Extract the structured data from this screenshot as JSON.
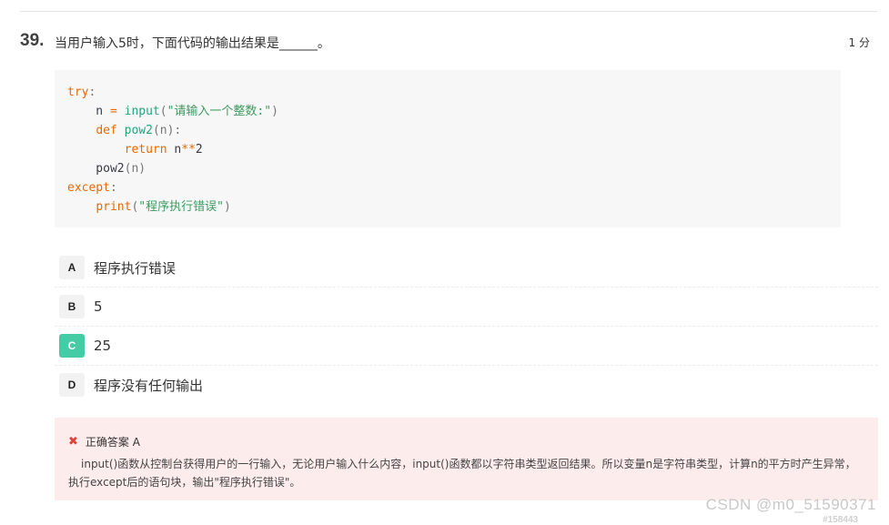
{
  "question": {
    "number": "39.",
    "text": "当用户输入5时，下面代码的输出结果是______。",
    "score": "1 分"
  },
  "code": {
    "lines": [
      [
        {
          "t": "try",
          "c": "kw"
        },
        {
          "t": ":",
          "c": "punc"
        }
      ],
      [
        {
          "t": "    n ",
          "c": ""
        },
        {
          "t": "=",
          "c": "op"
        },
        {
          "t": " ",
          "c": ""
        },
        {
          "t": "input",
          "c": "fn"
        },
        {
          "t": "(",
          "c": "punc"
        },
        {
          "t": "\"请输入一个整数:\"",
          "c": "str"
        },
        {
          "t": ")",
          "c": "punc"
        }
      ],
      [
        {
          "t": "    ",
          "c": ""
        },
        {
          "t": "def",
          "c": "kw"
        },
        {
          "t": " ",
          "c": ""
        },
        {
          "t": "pow2",
          "c": "fn"
        },
        {
          "t": "(n):",
          "c": "punc"
        }
      ],
      [
        {
          "t": "        ",
          "c": ""
        },
        {
          "t": "return",
          "c": "kw"
        },
        {
          "t": " n",
          "c": ""
        },
        {
          "t": "**",
          "c": "op"
        },
        {
          "t": "2",
          "c": ""
        }
      ],
      [
        {
          "t": "    pow2",
          "c": ""
        },
        {
          "t": "(n)",
          "c": "punc"
        }
      ],
      [
        {
          "t": "except",
          "c": "kw"
        },
        {
          "t": ":",
          "c": "punc"
        }
      ],
      [
        {
          "t": "    ",
          "c": ""
        },
        {
          "t": "print",
          "c": "kw"
        },
        {
          "t": "(",
          "c": "punc"
        },
        {
          "t": "\"程序执行错误\"",
          "c": "str"
        },
        {
          "t": ")",
          "c": "punc"
        }
      ]
    ]
  },
  "options": [
    {
      "letter": "A",
      "text": "程序执行错误",
      "correct": false
    },
    {
      "letter": "B",
      "text": "5",
      "correct": false
    },
    {
      "letter": "C",
      "text": "25",
      "correct": true
    },
    {
      "letter": "D",
      "text": "程序没有任何输出",
      "correct": false
    }
  ],
  "answer": {
    "icon": "x-icon",
    "label": "正确答案 A",
    "explanation": "input()函数从控制台获得用户的一行输入，无论用户输入什么内容，input()函数都以字符串类型返回结果。所以变量n是字符串类型，计算n的平方时产生异常，执行except后的语句块，输出\"程序执行错误\"。"
  },
  "watermark": {
    "main": "CSDN @m0_51590371",
    "sub": "#158443"
  },
  "colors": {
    "correct_badge": "#45cba5",
    "answer_bg": "#fdecec",
    "wrong_icon": "#e0403a",
    "keyword": "#e96900",
    "string": "#3c9b5e"
  }
}
